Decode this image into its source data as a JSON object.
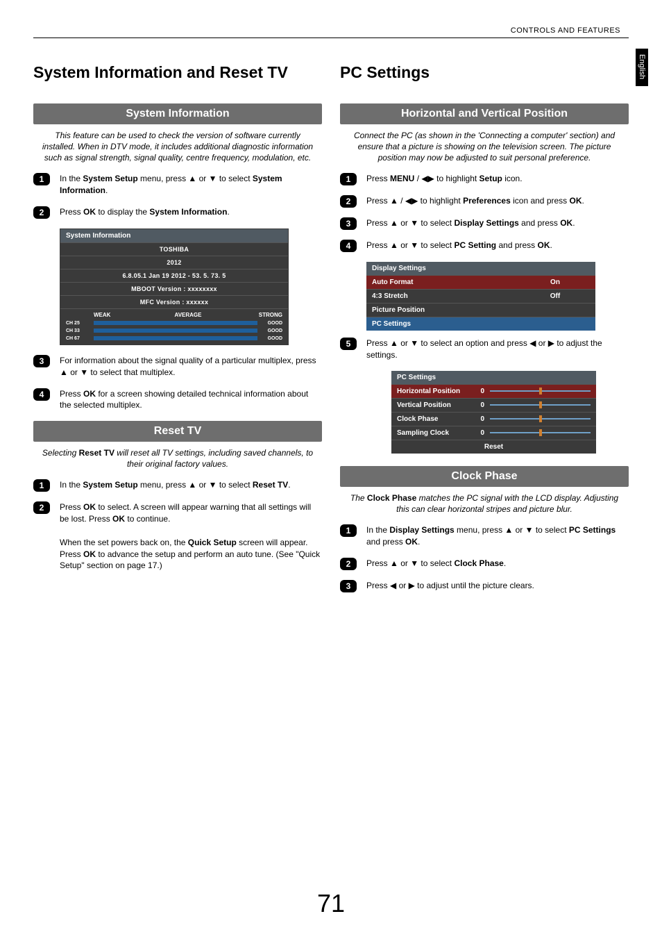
{
  "header": {
    "topRight": "CONTROLS AND FEATURES",
    "sideTab": "English"
  },
  "pageNumber": "71",
  "left": {
    "title": "System Information and Reset TV",
    "section1": {
      "heading": "System Information",
      "intro": "This feature can be used to check the version of software currently installed. When in DTV mode, it includes additional diagnostic information such as signal strength, signal quality, centre frequency, modulation, etc.",
      "steps": [
        {
          "n": "1",
          "pre": "In the ",
          "b1": "System Setup",
          "mid": " menu, press ▲ or ▼ to select ",
          "b2": "System Information",
          "post": "."
        },
        {
          "n": "2",
          "pre": "Press ",
          "b1": "OK",
          "mid": " to display the ",
          "b2": "System Information",
          "post": "."
        }
      ],
      "panel": {
        "title": "System Information",
        "rows": [
          "TOSHIBA",
          "2012",
          "6.8.05.1 Jan 19 2012 - 53. 5. 73. 5",
          "MBOOT Version : xxxxxxxx",
          "MFC Version : xxxxxx"
        ],
        "quality": {
          "weak": "WEAK",
          "average": "AVERAGE",
          "strong": "STRONG",
          "channels": [
            {
              "ch": "CH 25",
              "status": "GOOD"
            },
            {
              "ch": "CH 33",
              "status": "GOOD"
            },
            {
              "ch": "CH 67",
              "status": "GOOD"
            }
          ]
        }
      },
      "stepsAfter": [
        {
          "n": "3",
          "text": "For information about the signal quality of a particular multiplex, press ▲ or ▼ to select that multiplex."
        },
        {
          "n": "4",
          "pre": "Press ",
          "b1": "OK",
          "post": " for a screen showing detailed technical information about the selected multiplex."
        }
      ]
    },
    "section2": {
      "heading": "Reset TV",
      "intro_pre": "Selecting ",
      "intro_b": "Reset TV",
      "intro_post": " will reset all TV settings, including saved channels, to their original factory values.",
      "steps": [
        {
          "n": "1",
          "pre": "In the ",
          "b1": "System Setup",
          "mid": " menu, press ▲ or ▼ to select ",
          "b2": "Reset TV",
          "post": "."
        },
        {
          "n": "2",
          "pre": "Press ",
          "b1": "OK",
          "mid": " to select. A screen will appear warning that all settings will be lost. Press ",
          "b2": "OK",
          "post": " to continue."
        }
      ],
      "tail_pre": "When the set powers back on, the ",
      "tail_b1": "Quick Setup",
      "tail_mid": " screen will appear. Press ",
      "tail_b2": "OK",
      "tail_post": " to advance the setup and perform an auto tune. (See \"Quick Setup\" section on page 17.)"
    }
  },
  "right": {
    "title": "PC Settings",
    "section1": {
      "heading": "Horizontal and Vertical Position",
      "intro": "Connect the PC (as shown in the 'Connecting a computer' section) and ensure that a picture is showing on the television screen. The picture position may now be adjusted to suit personal preference.",
      "steps": [
        {
          "n": "1",
          "pre": "Press ",
          "b1": "MENU",
          "mid": " /  ◀▶ to highlight ",
          "b2": "Setup",
          "post": " icon."
        },
        {
          "n": "2",
          "pre": "Press ▲ / ◀▶ to highlight ",
          "b1": "Preferences",
          "mid": " icon and press ",
          "b2": "OK",
          "post": "."
        },
        {
          "n": "3",
          "pre": "Press ▲ or ▼ to select ",
          "b1": "Display Settings",
          "mid": " and press ",
          "b2": "OK",
          "post": "."
        },
        {
          "n": "4",
          "pre": "Press ▲ or ▼ to select ",
          "b1": "PC Setting",
          "mid": " and press ",
          "b2": "OK",
          "post": "."
        }
      ],
      "panel": {
        "title": "Display Settings",
        "rows": [
          {
            "label": "Auto Format",
            "value": "On",
            "cls": "highlight"
          },
          {
            "label": "4:3 Stretch",
            "value": "Off",
            "cls": ""
          },
          {
            "label": "Picture Position",
            "value": "",
            "cls": ""
          },
          {
            "label": "PC Settings",
            "value": "",
            "cls": "highlight2"
          }
        ]
      },
      "step5": {
        "n": "5",
        "text": "Press ▲ or ▼ to select an option and press ◀ or ▶ to adjust the settings."
      },
      "slider": {
        "title": "PC Settings",
        "rows": [
          {
            "label": "Horizontal Position",
            "val": "0",
            "cls": "highlight"
          },
          {
            "label": "Vertical Position",
            "val": "0",
            "cls": ""
          },
          {
            "label": "Clock Phase",
            "val": "0",
            "cls": ""
          },
          {
            "label": "Sampling Clock",
            "val": "0",
            "cls": ""
          }
        ],
        "reset": "Reset"
      }
    },
    "section2": {
      "heading": "Clock Phase",
      "intro_pre": "The ",
      "intro_b": "Clock Phase",
      "intro_post": " matches the PC signal with the LCD display. Adjusting this can clear horizontal stripes and picture blur.",
      "steps": [
        {
          "n": "1",
          "pre": "In the ",
          "b1": "Display Settings",
          "mid": " menu, press ▲ or ▼ to select ",
          "b2": "PC Settings",
          "post_mid": " and press ",
          "b3": "OK",
          "post": "."
        },
        {
          "n": "2",
          "pre": "Press ▲ or ▼ to select ",
          "b1": "Clock Phase",
          "post": "."
        },
        {
          "n": "3",
          "text": "Press ◀ or ▶ to adjust until the picture clears."
        }
      ]
    }
  }
}
